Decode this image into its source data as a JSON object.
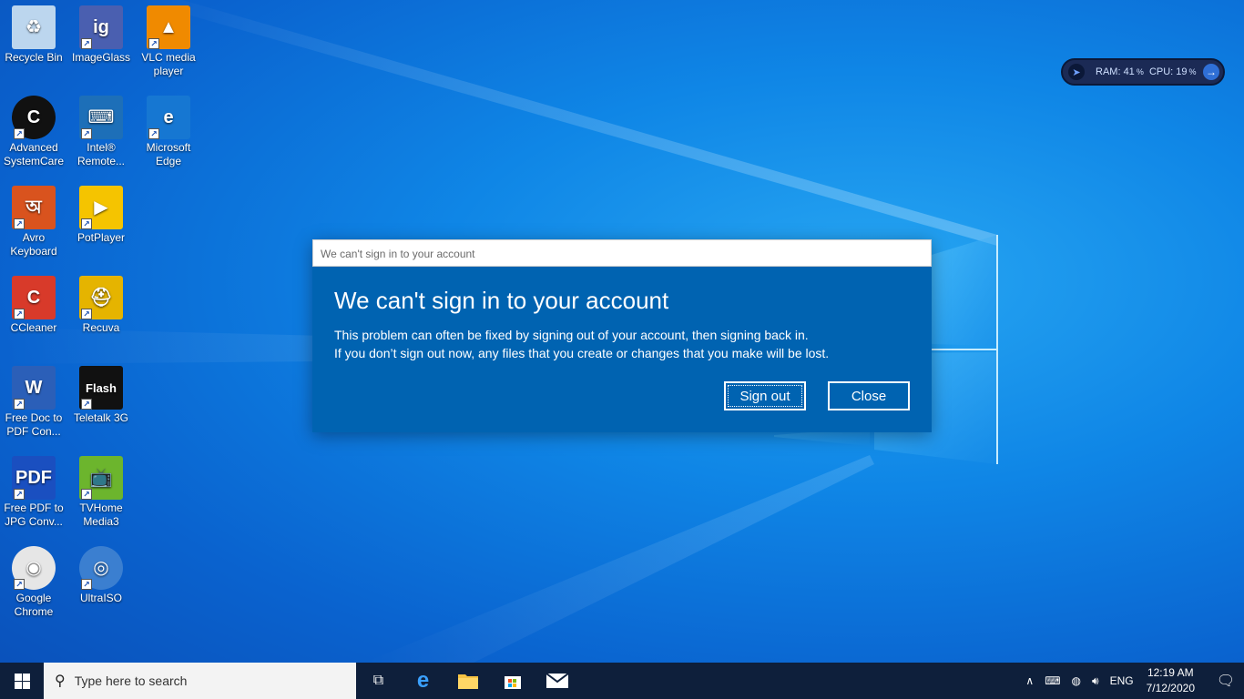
{
  "desktop_icons": [
    {
      "label": "Recycle Bin",
      "icon": "recycle-bin-icon",
      "color": "#bcd6ee",
      "glyph": "♻",
      "shortcut": false
    },
    {
      "label": "ImageGlass",
      "icon": "imageglass-icon",
      "color": "#4a5fb0",
      "glyph": "ig",
      "shortcut": true
    },
    {
      "label": "VLC media player",
      "icon": "vlc-icon",
      "color": "#f08a00",
      "glyph": "▲",
      "shortcut": true
    },
    {
      "label": "Advanced SystemCare",
      "icon": "advanced-systemcare-icon",
      "color": "#111111",
      "glyph": "C",
      "shortcut": true
    },
    {
      "label": "Intel® Remote...",
      "icon": "intel-remote-icon",
      "color": "#1d6fb8",
      "glyph": "⌨",
      "shortcut": true
    },
    {
      "label": "Microsoft Edge",
      "icon": "edge-icon",
      "color": "#1677d2",
      "glyph": "e",
      "shortcut": true
    },
    {
      "label": "Avro Keyboard",
      "icon": "avro-keyboard-icon",
      "color": "#d9531e",
      "glyph": "অ",
      "shortcut": true
    },
    {
      "label": "PotPlayer",
      "icon": "potplayer-icon",
      "color": "#f5c400",
      "glyph": "▶",
      "shortcut": true
    },
    {
      "label": "CCleaner",
      "icon": "ccleaner-icon",
      "color": "#d83a2a",
      "glyph": "C",
      "shortcut": true
    },
    {
      "label": "Recuva",
      "icon": "recuva-icon",
      "color": "#e5b400",
      "glyph": "⛑",
      "shortcut": true
    },
    {
      "label": "Free Doc to PDF Con...",
      "icon": "doc-to-pdf-icon",
      "color": "#2b5fb8",
      "glyph": "W",
      "shortcut": true
    },
    {
      "label": "Teletalk 3G",
      "icon": "teletalk-icon",
      "color": "#111111",
      "glyph": "Flash",
      "shortcut": true
    },
    {
      "label": "Free PDF to JPG Conv...",
      "icon": "pdf-to-jpg-icon",
      "color": "#1a4fc0",
      "glyph": "PDF",
      "shortcut": true
    },
    {
      "label": "TVHome Media3",
      "icon": "tvhome-icon",
      "color": "#6cb52d",
      "glyph": "📺",
      "shortcut": true
    },
    {
      "label": "Google Chrome",
      "icon": "chrome-icon",
      "color": "#e6e6e6",
      "glyph": "◉",
      "shortcut": true
    },
    {
      "label": "UltraISO",
      "icon": "ultraiso-icon",
      "color": "#3b7fd0",
      "glyph": "◎",
      "shortcut": true
    }
  ],
  "sysmon": {
    "ram_label": "RAM:",
    "ram_value": "41",
    "cpu_label": "CPU:",
    "cpu_value": "19",
    "unit": "%"
  },
  "dialog": {
    "window_title": "We can't sign in to your account",
    "heading": "We can't sign in to your account",
    "line1": "This problem can often be fixed by signing out of your account, then signing back in.",
    "line2": "If you don’t sign out now, any files that you create or changes that you make will be lost.",
    "sign_out_label": "Sign out",
    "close_label": "Close",
    "bg_color": "#0063b1"
  },
  "taskbar": {
    "search_placeholder": "Type here to search",
    "language": "ENG",
    "time": "12:19 AM",
    "date": "7/12/2020"
  }
}
